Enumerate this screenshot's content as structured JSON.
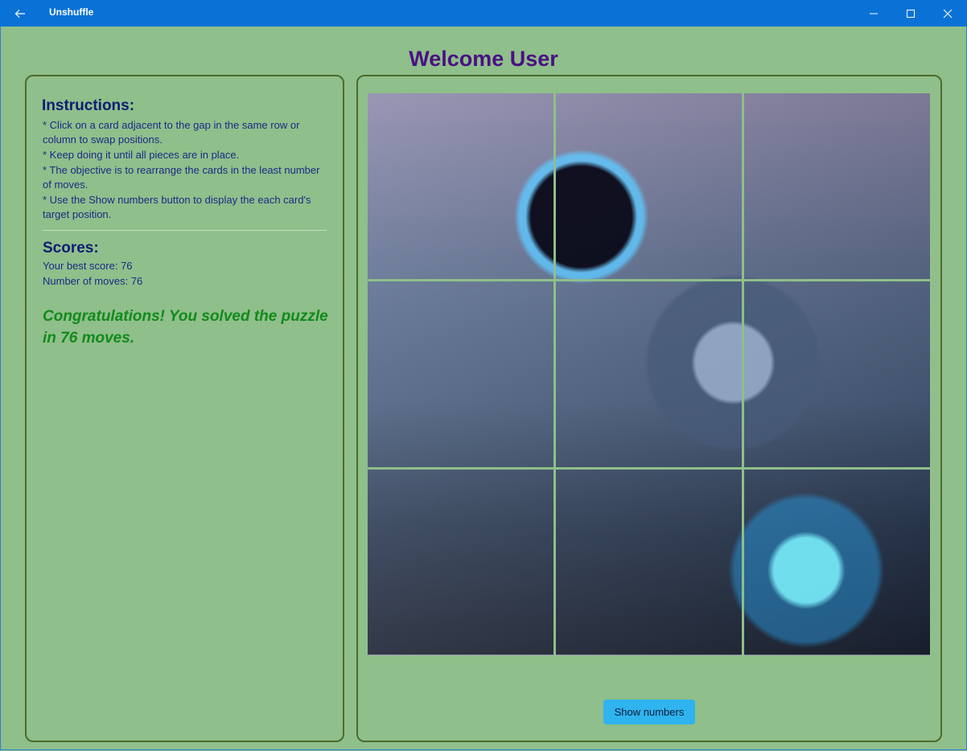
{
  "window": {
    "title": "Unshuffle",
    "back_icon": "back-arrow-icon",
    "controls": [
      "minimize-icon",
      "maximize-icon",
      "close-icon"
    ]
  },
  "header": {
    "welcome": "Welcome User"
  },
  "instructions": {
    "heading": "Instructions:",
    "items": [
      "* Click on a card adjacent to the gap in the same row or column to swap positions.",
      "* Keep doing it until all pieces are in place.",
      "* The objective is to rearrange the cards in the least number of moves.",
      "* Use the Show numbers button to display the each card's target position."
    ]
  },
  "scores": {
    "heading": "Scores:",
    "best": "Your best score: 76",
    "moves": "Number of moves: 76",
    "congrats": "Congratulations! You solved the puzzle in 76 moves."
  },
  "puzzle": {
    "rows": 3,
    "cols": 3
  },
  "buttons": {
    "show_numbers": "Show numbers"
  },
  "colors": {
    "titlebar": "#0a72d6",
    "background": "#8fbf8b",
    "heading": "#4b0f84",
    "text": "#1d2a86",
    "success": "#128a1b",
    "button": "#2fb4f0"
  }
}
